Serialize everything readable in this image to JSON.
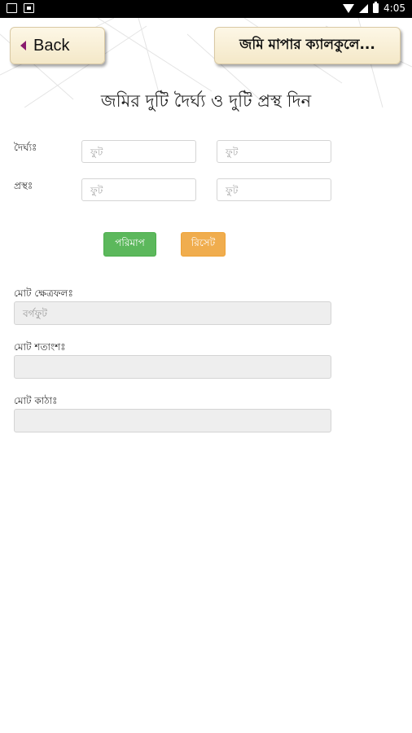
{
  "status_bar": {
    "time": "4:05",
    "icons": [
      "image-icon",
      "notification-icon",
      "wifi-icon",
      "cell-signal-icon",
      "battery-icon"
    ]
  },
  "header": {
    "back_label": "Back",
    "title": "জমি মাপার ক্যালকুলে..."
  },
  "main": {
    "heading": "জমির দুটি দৈর্ঘ্য ও দুটি প্রস্থ দিন",
    "length_label": "দৈর্ঘ্যঃ",
    "width_label": "প্রস্থঃ",
    "input_placeholder": "ফুট",
    "measure_button": "পরিমাপ",
    "reset_button": "রিসেট",
    "results": {
      "area_label": "মোট ক্ষেত্রফলঃ",
      "area_placeholder": "বর্গফুট",
      "decimal_label": "মোট শতাংশঃ",
      "katha_label": "মোট কাঠাঃ"
    }
  },
  "colors": {
    "measure_button": "#5cb85c",
    "reset_button": "#f0ad4e",
    "header_button_bg": "#f8efd7",
    "back_arrow": "#8a1a6e"
  }
}
